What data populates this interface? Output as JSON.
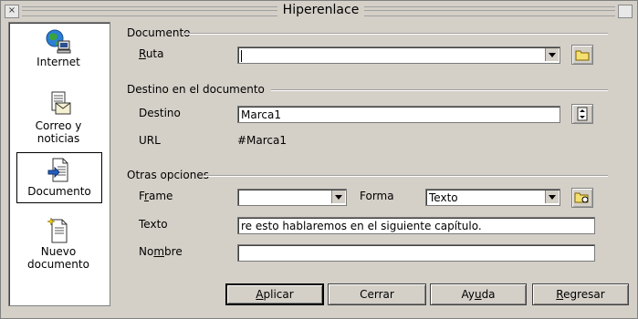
{
  "window": {
    "title": "Hiperenlace"
  },
  "sidebar": {
    "items": [
      {
        "label": "Internet",
        "icon": "globe-icon"
      },
      {
        "label": "Correo y noticias",
        "icon": "mail-icon"
      },
      {
        "label": "Documento",
        "icon": "document-icon",
        "selected": true
      },
      {
        "label_line1": "Nuevo",
        "label_line2": "documento",
        "icon": "new-document-icon"
      }
    ]
  },
  "documento": {
    "heading": "Documento",
    "ruta_label_pre": "",
    "ruta_label_u": "R",
    "ruta_label_post": "uta",
    "ruta_value": ""
  },
  "destino": {
    "heading": "Destino en el documento",
    "destino_label": "Destino",
    "destino_value": "Marca1",
    "url_label": "URL",
    "url_value": "#Marca1"
  },
  "opciones": {
    "heading": "Otras opciones",
    "frame_label_pre": "F",
    "frame_label_u": "r",
    "frame_label_post": "ame",
    "frame_value": "",
    "forma_label": "Forma",
    "forma_value": "Texto",
    "texto_label": "Texto",
    "texto_value": "re esto hablaremos en el siguiente capítulo.",
    "nombre_label_pre": "No",
    "nombre_label_u": "m",
    "nombre_label_post": "bre",
    "nombre_value": ""
  },
  "buttons": {
    "apply_pre": "",
    "apply_u": "A",
    "apply_post": "plicar",
    "close": "Cerrar",
    "help_pre": "Ay",
    "help_u": "u",
    "help_post": "da",
    "back_pre": "",
    "back_u": "R",
    "back_post": "egresar"
  },
  "colors": {
    "bg": "#d4d0c8",
    "field": "#ffffff",
    "border": "#808080"
  }
}
